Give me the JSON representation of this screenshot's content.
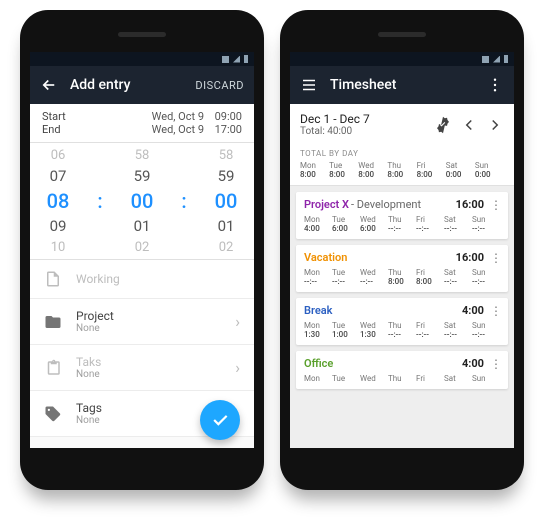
{
  "left": {
    "appbar": {
      "title": "Add entry",
      "discard": "DISCARD"
    },
    "start": {
      "label": "Start",
      "date": "Wed, Oct 9",
      "time": "09:00"
    },
    "end": {
      "label": "End",
      "date": "Wed, Oct 9",
      "time": "17:00"
    },
    "picker": {
      "r0": [
        "06",
        "58",
        "58"
      ],
      "r1": [
        "07",
        "59",
        "59"
      ],
      "sel": [
        "08",
        "00",
        "00"
      ],
      "r3": [
        "09",
        "01",
        "01"
      ],
      "r4": [
        "10",
        "02",
        "02"
      ]
    },
    "items": {
      "working": "Working",
      "project": {
        "title": "Project",
        "sub": "None"
      },
      "tasks": {
        "title": "Taks",
        "sub": "None"
      },
      "tags": {
        "title": "Tags",
        "sub": "None"
      }
    }
  },
  "right": {
    "appbar": {
      "title": "Timesheet"
    },
    "range": "Dec 1 - Dec 7",
    "total_label": "Total: 40:00",
    "tbd_label": "TOTAL BY DAY",
    "days": [
      {
        "n": "Mon",
        "v": "8:00"
      },
      {
        "n": "Tue",
        "v": "8:00"
      },
      {
        "n": "Wed",
        "v": "8:00"
      },
      {
        "n": "Thu",
        "v": "8:00"
      },
      {
        "n": "Fri",
        "v": "8:00"
      },
      {
        "n": "Sat",
        "v": "0:00"
      },
      {
        "n": "Sun",
        "v": "0:00"
      }
    ],
    "cards": [
      {
        "proj": "Project X",
        "proj_class": "proj-purple",
        "task": " - Development",
        "hours": "16:00",
        "days": [
          "4:00",
          "6:00",
          "6:00",
          "--:--",
          "--:--",
          "--:--",
          "--:--"
        ]
      },
      {
        "proj": "Vacation",
        "proj_class": "proj-orange",
        "task": "",
        "hours": "16:00",
        "days": [
          "--:--",
          "--:--",
          "--:--",
          "8:00",
          "8:00",
          "--:--",
          "--:--"
        ]
      },
      {
        "proj": "Break",
        "proj_class": "proj-blue",
        "task": "",
        "hours": "4:00",
        "days": [
          "1:30",
          "1:00",
          "1:30",
          "--:--",
          "--:--",
          "--:--",
          "--:--"
        ]
      },
      {
        "proj": "Office",
        "proj_class": "proj-green",
        "task": "",
        "hours": "4:00",
        "days": [
          "",
          "",
          "",
          "",
          "",
          "",
          ""
        ]
      }
    ],
    "day_names": [
      "Mon",
      "Tue",
      "Wed",
      "Thu",
      "Fri",
      "Sat",
      "Sun"
    ]
  }
}
